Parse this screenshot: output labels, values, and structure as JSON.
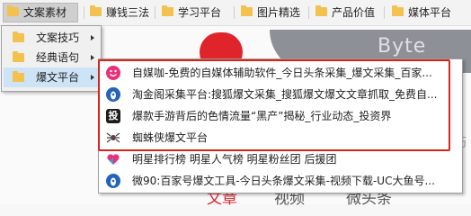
{
  "bookmarks_bar": {
    "items": [
      {
        "label": "文案素材",
        "active": true
      },
      {
        "label": "赚钱三法"
      },
      {
        "label": "学习平台"
      },
      {
        "label": "图片精选"
      },
      {
        "label": "产品价值"
      },
      {
        "label": "媒体平台"
      }
    ]
  },
  "folder_submenu": {
    "items": [
      {
        "label": "文案技巧"
      },
      {
        "label": "经典语句"
      },
      {
        "label": "爆文平台",
        "selected": true
      }
    ]
  },
  "links_menu": {
    "items": [
      {
        "label": "自媒咖-免费的自媒体辅助软件_今日头条采集_爆文采集_百家...",
        "icon": "smiley-icon"
      },
      {
        "label": "淘金阁采集平台:搜狐爆文采集_搜狐爆文爆文文章抓取_免费自...",
        "icon": "wolf-logo-icon"
      },
      {
        "label": "爆款手游背后的色情流量“黑产”揭秘_行业动态_投资界",
        "icon": "tou-logo-icon"
      },
      {
        "label": "蜘蛛侠爆文平台",
        "icon": "spider-icon"
      },
      {
        "label": "明星排行榜 明星人气榜 明星粉丝团 后援团",
        "icon": "heart-icon"
      },
      {
        "label": "微90:百家号爆文工具-今日头条爆文采集-视频下载-UC大鱼号...",
        "icon": "w-logo-icon"
      }
    ]
  },
  "background_page": {
    "banner_text": "Byte",
    "right_glyph": "巧",
    "tabs": [
      "文章",
      "视频",
      "微头条"
    ]
  },
  "colors": {
    "highlight": "#d8241b",
    "folder": "#f2c14e",
    "selected": "#cde3f6"
  }
}
